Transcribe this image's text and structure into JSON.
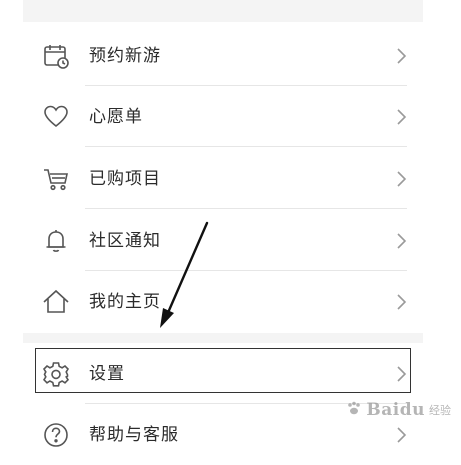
{
  "menu": {
    "items": [
      {
        "label": "预约新游",
        "icon": "calendar-clock-icon"
      },
      {
        "label": "心愿单",
        "icon": "heart-icon"
      },
      {
        "label": "已购项目",
        "icon": "cart-icon"
      },
      {
        "label": "社区通知",
        "icon": "bell-icon"
      },
      {
        "label": "我的主页",
        "icon": "home-icon"
      },
      {
        "label": "设置",
        "icon": "gear-icon"
      },
      {
        "label": "帮助与客服",
        "icon": "question-icon"
      }
    ],
    "highlighted_item": "设置"
  },
  "watermark": {
    "brand": "Baidu",
    "sub": "经验"
  },
  "colors": {
    "section_band": "#f4f4f4",
    "text": "#2b2b2b",
    "icon_stroke": "#555555",
    "chevron": "#9a9a9a",
    "highlight_border": "#333333",
    "arrow": "#111111"
  }
}
